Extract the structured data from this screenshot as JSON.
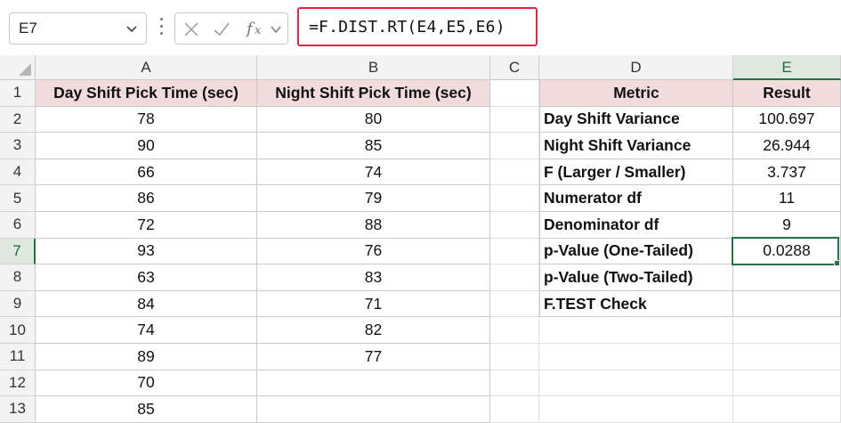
{
  "namebox": {
    "value": "E7"
  },
  "formula_bar": {
    "formula": "=F.DIST.RT(E4,E5,E6)"
  },
  "icons": {
    "namebox_dropdown": "chevron-down-icon",
    "cancel": "cross-icon",
    "enter": "check-icon",
    "function": "fx-icon",
    "formula_expand": "chevron-down-icon",
    "select_all": "triangle-icon"
  },
  "colors": {
    "header_fill": "#f2dcdb",
    "selection": "#217346",
    "formula_highlight": "#d8284b"
  },
  "columns": [
    "A",
    "B",
    "C",
    "D",
    "E"
  ],
  "rows": [
    "1",
    "2",
    "3",
    "4",
    "5",
    "6",
    "7",
    "8",
    "9",
    "10",
    "11",
    "12",
    "13"
  ],
  "selected": {
    "column": "E",
    "row": "7"
  },
  "sheet": {
    "a_header": "Day Shift Pick Time (sec)",
    "b_header": "Night Shift Pick Time (sec)",
    "day_shift": [
      "78",
      "90",
      "66",
      "86",
      "72",
      "93",
      "63",
      "84",
      "74",
      "89",
      "70",
      "85"
    ],
    "night_shift": [
      "80",
      "85",
      "74",
      "79",
      "88",
      "76",
      "83",
      "71",
      "82",
      "77"
    ],
    "metric_table": {
      "headers": [
        "Metric",
        "Result"
      ],
      "rows": [
        {
          "metric": "Day Shift Variance",
          "result": "100.697"
        },
        {
          "metric": "Night Shift Variance",
          "result": "26.944"
        },
        {
          "metric": "F (Larger / Smaller)",
          "result": "3.737"
        },
        {
          "metric": "Numerator df",
          "result": "11"
        },
        {
          "metric": "Denominator df",
          "result": "9"
        },
        {
          "metric": "p-Value (One-Tailed)",
          "result": "0.0288"
        },
        {
          "metric": "p-Value (Two-Tailed)",
          "result": ""
        },
        {
          "metric": "F.TEST Check",
          "result": ""
        }
      ]
    }
  }
}
